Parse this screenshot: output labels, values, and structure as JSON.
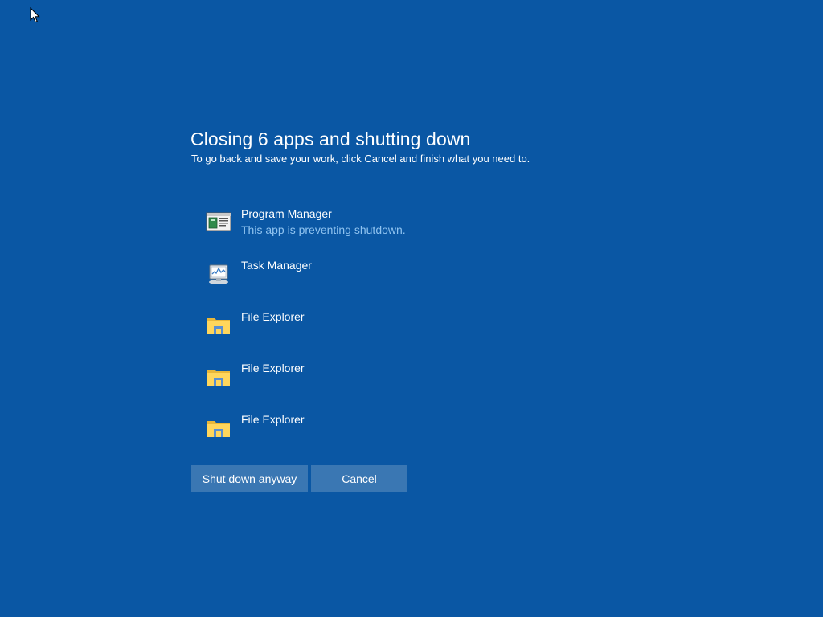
{
  "colors": {
    "background": "#0a57a4",
    "button_bg": "#3a77b3",
    "status_text": "#8fc3f0",
    "text": "#ffffff"
  },
  "title": "Closing 6 apps and shutting down",
  "subtitle": "To go back and save your work, click Cancel and finish what you need to.",
  "apps": [
    {
      "name": "Program Manager",
      "status": "This app is preventing shutdown.",
      "icon": "program-manager-icon"
    },
    {
      "name": "Task Manager",
      "status": "",
      "icon": "task-manager-icon"
    },
    {
      "name": "File Explorer",
      "status": "",
      "icon": "folder-icon"
    },
    {
      "name": "File Explorer",
      "status": "",
      "icon": "folder-icon"
    },
    {
      "name": "File Explorer",
      "status": "",
      "icon": "folder-icon"
    }
  ],
  "buttons": {
    "shutdown_label": "Shut down anyway",
    "cancel_label": "Cancel"
  }
}
